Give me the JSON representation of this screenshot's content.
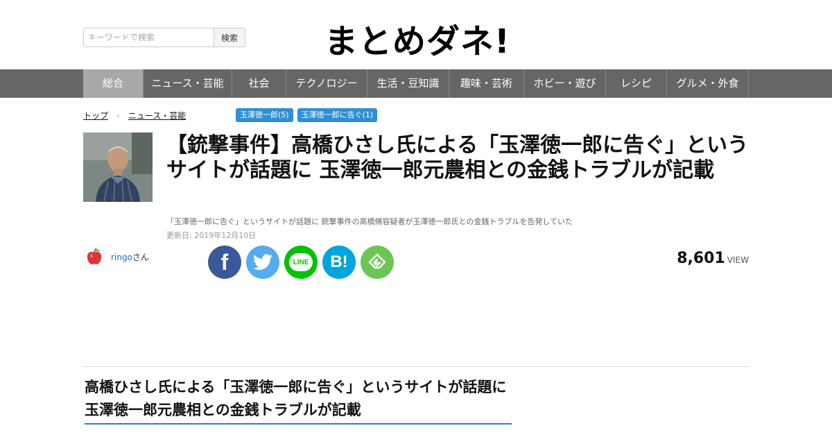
{
  "search": {
    "placeholder": "キーワードで検索",
    "button_label": "検索"
  },
  "site": {
    "logo": "まとめダネ!"
  },
  "nav": {
    "items": [
      {
        "label": "総合",
        "active": true
      },
      {
        "label": "ニュース・芸能",
        "active": false
      },
      {
        "label": "社会",
        "active": false
      },
      {
        "label": "テクノロジー",
        "active": false
      },
      {
        "label": "生活・豆知識",
        "active": false
      },
      {
        "label": "趣味・芸術",
        "active": false
      },
      {
        "label": "ホビー・遊び",
        "active": false
      },
      {
        "label": "レシピ",
        "active": false
      },
      {
        "label": "グルメ・外食",
        "active": false
      }
    ]
  },
  "breadcrumb": {
    "items": [
      "トップ",
      "ニュース・芸能"
    ],
    "separator": "›"
  },
  "tags": [
    "玉澤徳一郎(5)",
    "玉澤徳一郎に告ぐ(1)"
  ],
  "article": {
    "title": "【銃撃事件】高橋ひさし氏による「玉澤徳一郎に告ぐ」というサイトが話題に 玉澤徳一郎元農相との金銭トラブルが記載",
    "description": "「玉澤徳一郎に告ぐ」というサイトが話題に 銃撃事件の高橋脩容疑者が玉澤徳一郎氏との金銭トラブルを告発していた",
    "updated": "更新日: 2019年12月10日",
    "author_name": "ringo",
    "author_suffix": "さん",
    "views": "8,601",
    "views_label": "VIEW",
    "section_heading": "高橋ひさし氏による「玉澤徳一郎に告ぐ」というサイトが話題に 玉澤徳一郎元農相との金銭トラブルが記載"
  },
  "share": {
    "facebook": {
      "icon": "facebook-icon",
      "color": "#3b5998",
      "glyph": "f"
    },
    "twitter": {
      "icon": "twitter-icon",
      "color": "#55acee"
    },
    "line": {
      "icon": "line-icon",
      "color": "#00c300",
      "glyph": "LINE"
    },
    "hatena": {
      "icon": "hatena-bookmark-icon",
      "color": "#00a4de",
      "glyph": "B!"
    },
    "feedly": {
      "icon": "feedly-icon",
      "color": "#6cc655"
    }
  },
  "colors": {
    "accent": "#2e8fd8",
    "nav_bg": "#666666",
    "nav_active": "#a8a8a8"
  }
}
